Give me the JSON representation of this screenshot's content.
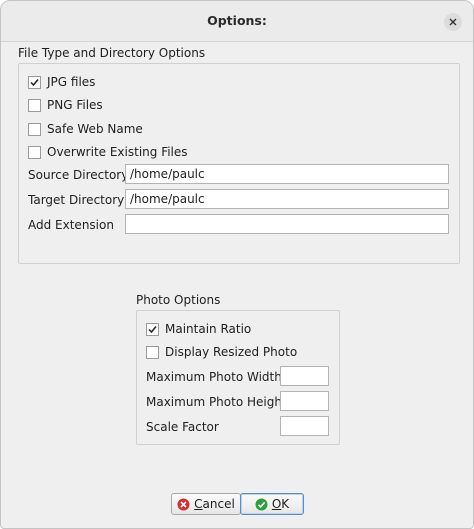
{
  "window": {
    "title": "Options:"
  },
  "file_section": {
    "title": "File Type and Directory Options",
    "checkboxes": [
      {
        "label": "JPG files",
        "checked": true
      },
      {
        "label": "PNG Files",
        "checked": false
      },
      {
        "label": "Safe Web Name",
        "checked": false
      },
      {
        "label": "Overwrite Existing Files",
        "checked": false
      }
    ],
    "fields": [
      {
        "label": "Source Directory",
        "value": "/home/paulc"
      },
      {
        "label": "Target Directory",
        "value": "/home/paulc"
      },
      {
        "label": "Add Extension",
        "value": ""
      }
    ]
  },
  "photo_section": {
    "title": "Photo Options",
    "checkboxes": [
      {
        "label": "Maintain Ratio",
        "checked": true
      },
      {
        "label": "Display Resized Photo",
        "checked": false
      }
    ],
    "fields": [
      {
        "label": "Maximum Photo Width",
        "value": ""
      },
      {
        "label": "Maximum Photo Height",
        "value": ""
      },
      {
        "label": "Scale Factor",
        "value": ""
      }
    ]
  },
  "buttons": {
    "cancel_first": "C",
    "cancel_rest": "ancel",
    "ok_first": "O",
    "ok_rest": "K",
    "cancel_icon": "cancel-icon",
    "ok_icon": "ok-check-icon",
    "cancel_color": "#d32f2f",
    "ok_color": "#2e9e3e"
  }
}
